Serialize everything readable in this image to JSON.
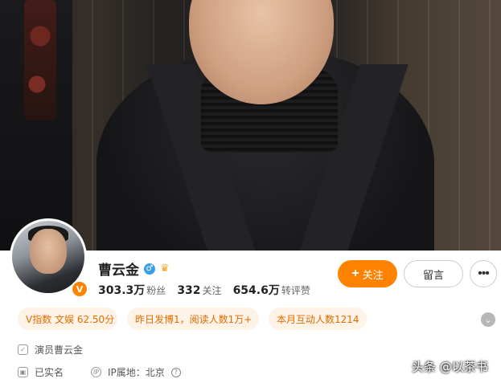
{
  "profile": {
    "name": "曹云金",
    "verified_badge": "V",
    "gender_icon": "male-icon",
    "stats": [
      {
        "num": "303.3万",
        "label": "粉丝"
      },
      {
        "num": "332",
        "label": "关注"
      },
      {
        "num": "654.6万",
        "label": "转评赞"
      }
    ]
  },
  "actions": {
    "follow_label": "关注",
    "message_label": "留言",
    "more_label": "•••"
  },
  "tags": [
    "V指数 文娱 62.50分",
    "昨日发博1，阅读人数1万+",
    "本月互动人数1214"
  ],
  "info": {
    "description": "演员曹云金",
    "realname": "已实名",
    "ip_label": "IP属地：北京"
  },
  "watermark": "头条 @以茶书",
  "colors": {
    "accent": "#ff8200",
    "tag_bg": "#fff3e8",
    "tag_text": "#e06d00"
  }
}
